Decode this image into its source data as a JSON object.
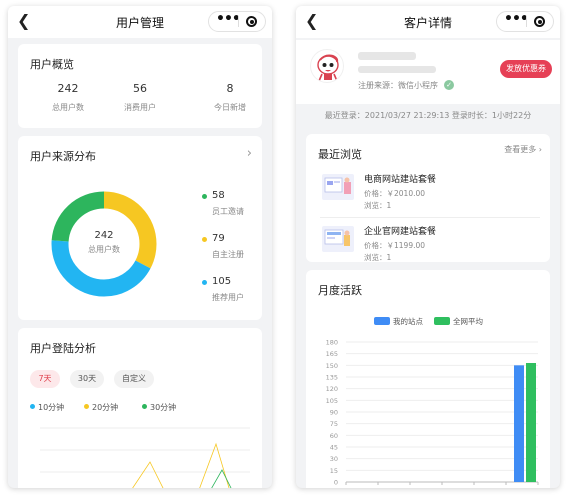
{
  "left": {
    "nav_title": "用户管理",
    "overview": {
      "title": "用户概览",
      "stats": [
        {
          "value": "242",
          "label": "总用户数"
        },
        {
          "value": "56",
          "label": "消费用户"
        },
        {
          "value": "8",
          "label": "今日新增"
        }
      ]
    },
    "source": {
      "title": "用户来源分布",
      "center_value": "242",
      "center_label": "总用户数",
      "segments": [
        {
          "value": 58,
          "label": "员工邀请",
          "color": "#2db55d"
        },
        {
          "value": 79,
          "label": "自主注册",
          "color": "#f6c722"
        },
        {
          "value": 105,
          "label": "推荐用户",
          "color": "#22b5f2"
        }
      ]
    },
    "login": {
      "title": "用户登陆分析",
      "tabs": [
        "7天",
        "30天",
        "自定义"
      ],
      "active_tab": "7天",
      "series": [
        {
          "name": "10分钟",
          "color": "#22b5f2"
        },
        {
          "name": "20分钟",
          "color": "#f6c722"
        },
        {
          "name": "30分钟",
          "color": "#2db55d"
        }
      ]
    }
  },
  "right": {
    "nav_title": "客户详情",
    "profile": {
      "source_text": "注册来源：微信小程序",
      "coupon_button": "发放优惠券"
    },
    "info_bar": "最近登录：2021/03/27 21:29:13   登录时长：1小时22分",
    "recent": {
      "title": "最近浏览",
      "more": "查看更多",
      "items": [
        {
          "name": "电商网站建站套餐",
          "price": "价格：￥2010.00",
          "views": "浏览：1"
        },
        {
          "name": "企业官网建站套餐",
          "price": "价格：￥1199.00",
          "views": "浏览：1"
        }
      ]
    },
    "monthly": {
      "title": "月度活跃",
      "legend": [
        {
          "name": "我的站点",
          "color": "#3f8cf5"
        },
        {
          "name": "全网平均",
          "color": "#2fbf5f"
        }
      ]
    }
  },
  "chart_data": [
    {
      "type": "pie",
      "title": "用户来源分布",
      "categories": [
        "员工邀请",
        "自主注册",
        "推荐用户"
      ],
      "values": [
        58,
        79,
        105
      ],
      "center_text": "242 总用户数"
    },
    {
      "type": "bar",
      "title": "月度活跃",
      "series": [
        {
          "name": "我的站点",
          "values": [
            150
          ]
        },
        {
          "name": "全网平均",
          "values": [
            153
          ]
        }
      ],
      "yticks": [
        0,
        15,
        30,
        45,
        60,
        75,
        90,
        105,
        120,
        135,
        150,
        165,
        180
      ],
      "ylim": [
        0,
        180
      ]
    }
  ]
}
